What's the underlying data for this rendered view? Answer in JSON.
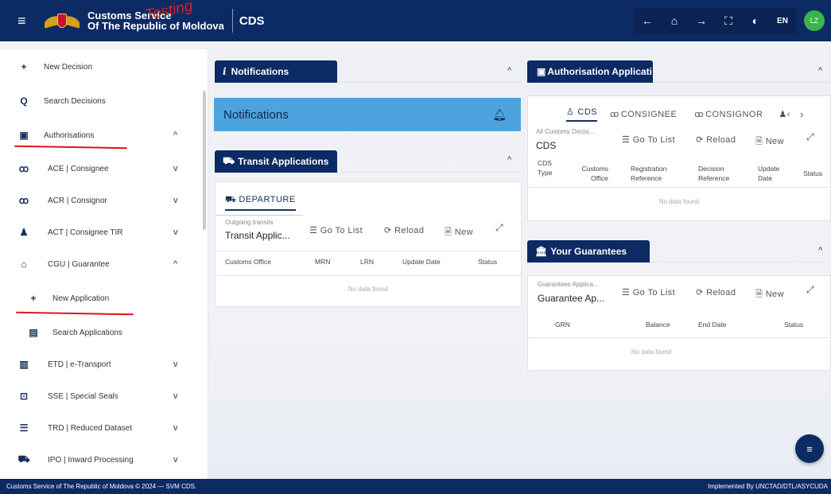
{
  "header": {
    "brand_line1": "Customs Service",
    "brand_line2": "Of The Republic of Moldova",
    "stamp": "Testing",
    "app_name": "CDS",
    "lang": "EN",
    "avatar": "LZ",
    "icons": [
      "menu-icon",
      "arrow-left-icon",
      "home-icon",
      "arrow-right-icon",
      "fullscreen-icon",
      "theme-icon"
    ]
  },
  "sidebar": {
    "items": [
      {
        "icon": "+",
        "label": "New Decision",
        "chev": ""
      },
      {
        "icon": "Q",
        "label": "Search Decisions",
        "chev": ""
      },
      {
        "icon": "▣",
        "label": "Authorisations",
        "chev": "^"
      },
      {
        "icon": "ꝏ",
        "label": "ACE | Consignee",
        "chev": "v"
      },
      {
        "icon": "ꝏ",
        "label": "ACR | Consignor",
        "chev": "v"
      },
      {
        "icon": "♟",
        "label": "ACT | Consignee TIR",
        "chev": "v"
      },
      {
        "icon": "⌂",
        "label": "CGU | Guarantee",
        "chev": "^"
      },
      {
        "icon": "+",
        "label": "New Application",
        "chev": ""
      },
      {
        "icon": "▤",
        "label": "Search Applications",
        "chev": ""
      },
      {
        "icon": "▥",
        "label": "ETD | e-Transport",
        "chev": "v"
      },
      {
        "icon": "⊡",
        "label": "SSE | Special Seals",
        "chev": "v"
      },
      {
        "icon": "☰",
        "label": "TRD | Reduced Dataset",
        "chev": "v"
      },
      {
        "icon": "⛟",
        "label": "IPO | Inward Processing",
        "chev": "v"
      }
    ]
  },
  "notifications": {
    "title": "Notifications",
    "title_icon": "i",
    "banner": "Notifications"
  },
  "transit": {
    "title": "Transit Applications",
    "tab": "DEPARTURE",
    "list_head": "Outgoing transits",
    "list_title": "Transit Applic...",
    "go_to_list": "Go To List",
    "reload": "Reload",
    "new": "New",
    "columns": [
      "Customs Office",
      "MRN",
      "LRN",
      "Update Date",
      "Status"
    ],
    "empty": "No data found"
  },
  "authorisation": {
    "title": "Authorisation Applicati",
    "tabs": [
      "CDS",
      "CONSIGNEE",
      "CONSIGNOR"
    ],
    "list_head": "All Customs Decisi...",
    "list_title": "CDS",
    "go_to_list": "Go To List",
    "reload": "Reload",
    "new": "New",
    "col1a": "CDS",
    "col1b": "Type",
    "col2a": "Customs",
    "col2b": "Office",
    "col3a": "Registration",
    "col3b": "Reference",
    "col4a": "Decision",
    "col4b": "Reference",
    "col5a": "Update",
    "col5b": "Date",
    "col6": "Status",
    "empty": "No data found"
  },
  "guarantees": {
    "title": "Your Guarantees",
    "list_head": "Guarantees Applica...",
    "list_title": "Guarantee Ap...",
    "go_to_list": "Go To List",
    "reload": "Reload",
    "new": "New",
    "columns": [
      "GRN",
      "Balance",
      "End Date",
      "Status"
    ],
    "empty": "No data found"
  },
  "footer": {
    "left": "Customs Service of The Republic of Moldova © 2024 — SVM CDS.",
    "right": "Implemented By UNCTAD/DTL/ASYCUDA"
  }
}
